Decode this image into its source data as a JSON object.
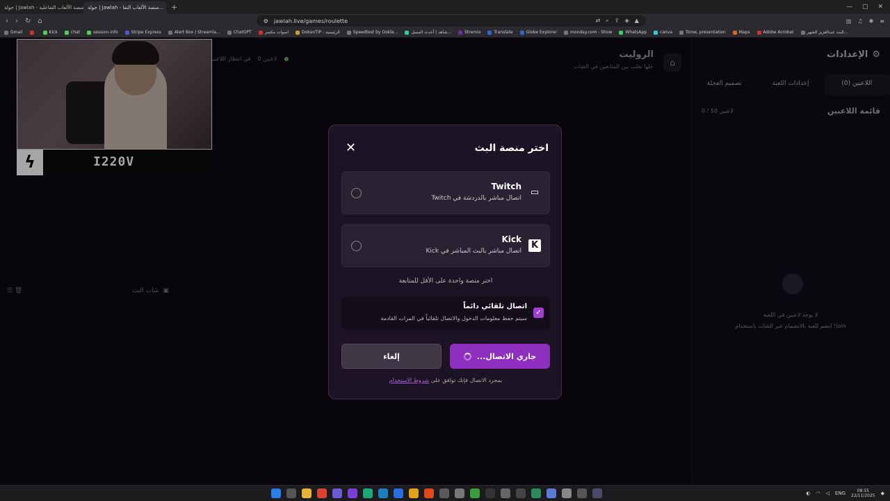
{
  "browser": {
    "tabs": [
      {
        "title": "جولة | Jawlah - منصة الألعاب التفاعلية",
        "active": false
      },
      {
        "title": "جولة | Jawlah - منصة الألعاب التفا...",
        "active": true
      }
    ],
    "url": "jawlah.live/games/roulette",
    "bookmarks": [
      "Gmail",
      "",
      "Kick",
      "chat",
      "session-info",
      "Stripe Express",
      "Alert Box / Streamla...",
      "ChatGPT",
      "اصوات مكسر",
      "DokanTIP - الرئيسية",
      "Speedtest by Ookla...",
      "شاهد | أحدث المسل...",
      "Stremio",
      "Translate",
      "Globe Explorer",
      "monday.com - Show",
      "WhatsApp",
      "canva",
      "Tome, presentation",
      "Maps",
      "Adobe Acrobat",
      "البث عبدالعزيز الشهر..."
    ]
  },
  "page": {
    "title": "الروليت",
    "subtitle": "خلها تقلب بين المتابعين في الشات",
    "status_players": "0 لاعبين",
    "status_waiting": "في انتظار اللاعبين",
    "chat_label": "شات البث"
  },
  "sidepanel": {
    "title": "الإعدادات",
    "tabs": [
      "اللاعبين (0)",
      "إعدادات اللعبة",
      "تصميم العجلة"
    ],
    "list_title": "قائمة اللاعبين",
    "count": "0 / 50 لاعبين",
    "empty_line1": "لا يوجد لاعبين في اللعبة",
    "empty_line2": "انضم للعبة بالانضمام عبر الشات باستخدام !join"
  },
  "webcam": {
    "name": "I220V"
  },
  "modal": {
    "title": "اختر منصة البث",
    "options": [
      {
        "name": "Twitch",
        "desc": "اتصال مباشر بالدردشة في Twitch",
        "icon": "twitch-icon"
      },
      {
        "name": "Kick",
        "desc": "اتصال مباشر بالبث المباشر في Kick",
        "icon": "kick-icon"
      }
    ],
    "hint": "اختر منصة واحدة على الأقل للمتابعة",
    "auto_title": "اتصال تلقائي دائماً",
    "auto_desc": "سيتم حفظ معلومات الدخول والاتصال تلقائياً في المرات القادمة",
    "auto_checked": true,
    "cancel_label": "إلغاء",
    "connect_label": "جاري الاتصال...",
    "terms_prefix": "بمجرد الاتصال فإنك توافق على",
    "terms_link": "شروط الاستخدام"
  },
  "taskbar": {
    "lang": "ENG",
    "time": "08:55",
    "date": "22/11/2025"
  }
}
